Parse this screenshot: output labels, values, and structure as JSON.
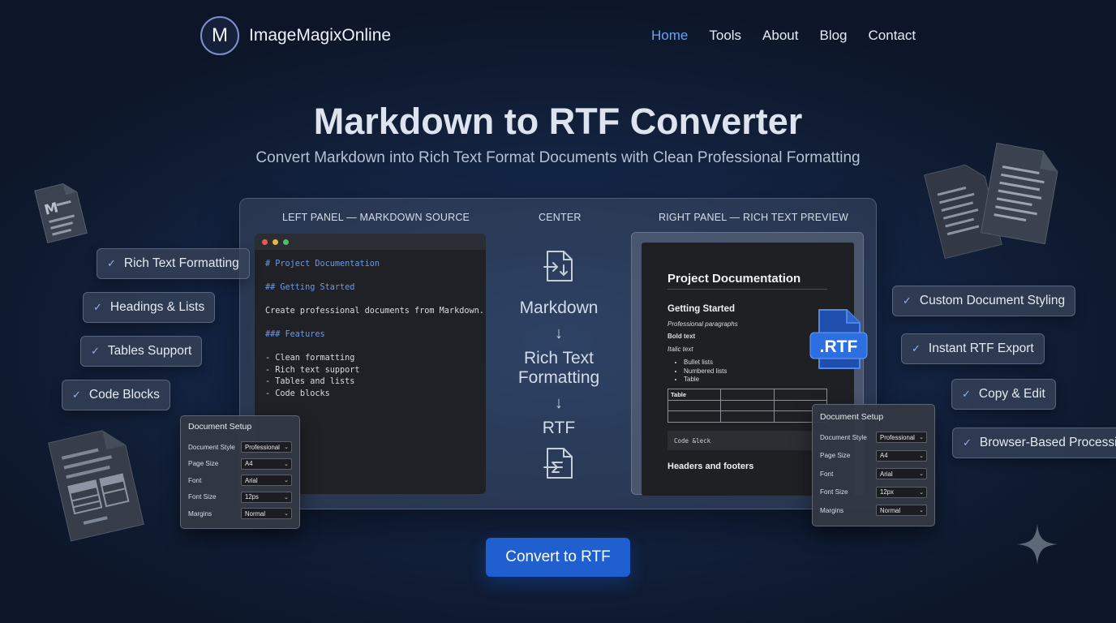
{
  "brand": {
    "logo_letter": "M",
    "name": "ImageMagixOnline"
  },
  "nav": [
    {
      "label": "Home",
      "active": true
    },
    {
      "label": "Tools"
    },
    {
      "label": "About"
    },
    {
      "label": "Blog"
    },
    {
      "label": "Contact"
    }
  ],
  "hero": {
    "title": "Markdown to RTF Converter",
    "subtitle": "Convert Markdown into Rich Text Format Documents with Clean Professional Formatting"
  },
  "panels": {
    "left_label": "LEFT PANEL — MARKDOWN SOURCE",
    "center_label": "CENTER",
    "right_label": "RIGHT PANEL — RICH TEXT PREVIEW"
  },
  "editor": {
    "lines": [
      "# Project Documentation",
      "",
      "## Getting Started",
      "",
      "Create professional documents from Markdown.",
      "",
      "### Features",
      "",
      "- Clean formatting",
      "- Rich text support",
      "- Tables and lists",
      "- Code blocks"
    ]
  },
  "flow": {
    "step1": "Markdown",
    "step2": "Rich Text Formatting",
    "step3": "RTF"
  },
  "preview": {
    "title": "Project Documentation",
    "heading": "Getting Started",
    "italic_line": "Professional paragraphs",
    "bold_line": "Bold text",
    "italic_text": "Italic text",
    "bullets": [
      "Bullet lists",
      "Numbered lists",
      "Table"
    ],
    "table_header": "Table",
    "code_text": "Code &leck",
    "footer_text": "Headers and footers"
  },
  "rtf_badge": ".RTF",
  "features_left": [
    "Rich Text Formatting",
    "Headings & Lists",
    "Tables Support",
    "Code Blocks"
  ],
  "features_right": [
    "Custom Document Styling",
    "Instant RTF Export",
    "Copy & Edit",
    "Browser-Based Processing"
  ],
  "setup_left": {
    "title": "Document Setup",
    "rows": [
      {
        "label": "Document Style",
        "value": "Professional"
      },
      {
        "label": "Page Size",
        "value": "A4"
      },
      {
        "label": "Font",
        "value": "Arial"
      },
      {
        "label": "Font Size",
        "value": "12ps"
      },
      {
        "label": "Margins",
        "value": "Normal"
      }
    ]
  },
  "setup_right": {
    "title": "Document Setup",
    "rows": [
      {
        "label": "Document Style",
        "value": "Professional"
      },
      {
        "label": "Page Size",
        "value": "A4"
      },
      {
        "label": "Font",
        "value": "Arial"
      },
      {
        "label": "Font Size",
        "value": "12px"
      },
      {
        "label": "Margins",
        "value": "Normal"
      }
    ]
  },
  "cta": {
    "label": "Convert to RTF"
  },
  "colors": {
    "accent": "#1f5fd0",
    "nav_active": "#6ea0f0",
    "code_heading": "#6c9ae6"
  }
}
